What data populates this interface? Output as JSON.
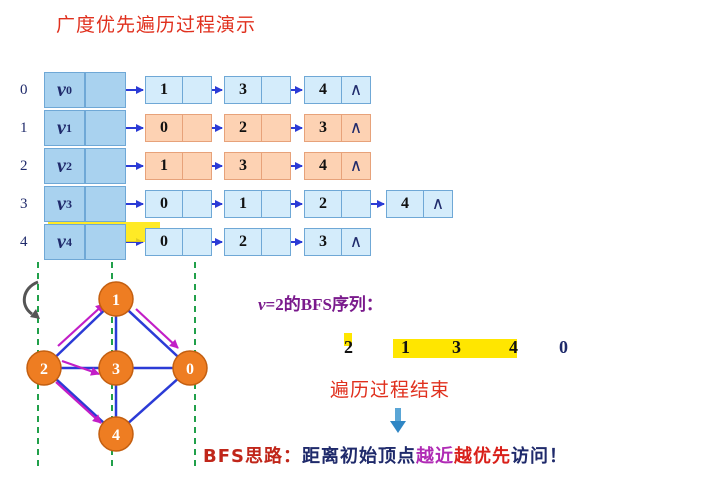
{
  "title": "广度优先遍历过程演示",
  "rows": [
    {
      "index": "0",
      "vertex": "v",
      "sub": "0",
      "adj": [
        "1",
        "3",
        "4"
      ]
    },
    {
      "index": "1",
      "vertex": "v",
      "sub": "1",
      "adj": [
        "0",
        "2",
        "3"
      ]
    },
    {
      "index": "2",
      "vertex": "v",
      "sub": "2",
      "adj": [
        "1",
        "3",
        "4"
      ]
    },
    {
      "index": "3",
      "vertex": "v",
      "sub": "3",
      "adj": [
        "0",
        "1",
        "2",
        "4"
      ]
    },
    {
      "index": "4",
      "vertex": "v",
      "sub": "4",
      "adj": [
        "0",
        "2",
        "3"
      ]
    }
  ],
  "null_symbol": "∧",
  "graph_nodes": [
    "1",
    "2",
    "3",
    "0",
    "4"
  ],
  "bfs": {
    "label_var": "v",
    "label_rest": "=2的BFS序列：",
    "sequence": [
      "2",
      "1",
      "3",
      "4",
      "0"
    ]
  },
  "end_text": "遍历过程结束",
  "idea": {
    "head": "BFS思路：",
    "part1": "距离初始顶点",
    "hl1": "越近",
    "hl2": "越优先",
    "part2": "访问！"
  },
  "colors": {
    "accent_red": "#e0301e",
    "node_orange": "#ee7d22",
    "arrow_blue": "#2b3bd6",
    "arrow_magenta": "#c21ec7",
    "dashed_green": "#21a04a",
    "highlight_yellow": "#ffe600"
  }
}
